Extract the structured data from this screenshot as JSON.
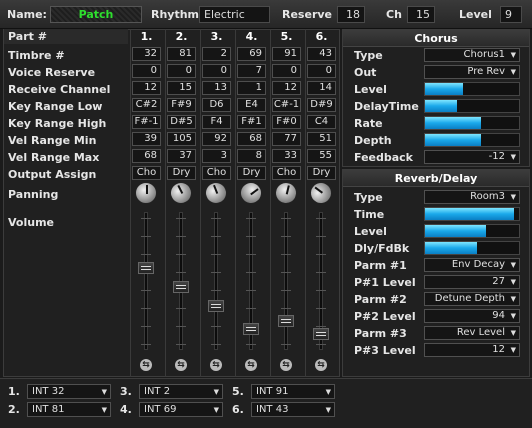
{
  "top": {
    "name_label": "Name:",
    "name_value": "Patch",
    "rhythm_label": "Rhythm",
    "rhythm_value": "Electric",
    "reserve_label": "Reserve",
    "reserve_value": "18",
    "ch_label": "Ch",
    "ch_value": "15",
    "level_label": "Level",
    "level_value": "9"
  },
  "parts": {
    "header_label": "Part #",
    "columns": [
      "1.",
      "2.",
      "3.",
      "4.",
      "5.",
      "6."
    ],
    "rows": [
      {
        "label": "Timbre #",
        "values": [
          "32",
          "81",
          "2",
          "69",
          "91",
          "43"
        ]
      },
      {
        "label": "Voice Reserve",
        "values": [
          "0",
          "0",
          "0",
          "7",
          "0",
          "0"
        ]
      },
      {
        "label": "Receive Channel",
        "values": [
          "12",
          "15",
          "13",
          "1",
          "12",
          "14"
        ]
      },
      {
        "label": "Key Range Low",
        "values": [
          "C#2",
          "F#9",
          "D6",
          "E4",
          "C#-1",
          "D#9"
        ]
      },
      {
        "label": "Key Range High",
        "values": [
          "F#-1",
          "D#5",
          "F4",
          "F#1",
          "F#0",
          "C4"
        ]
      },
      {
        "label": "Vel Range Min",
        "values": [
          "39",
          "105",
          "92",
          "68",
          "77",
          "51"
        ]
      },
      {
        "label": "Vel Range Max",
        "values": [
          "68",
          "37",
          "3",
          "8",
          "33",
          "55"
        ]
      },
      {
        "label": "Output Assign",
        "values": [
          "Cho",
          "Dry",
          "Cho",
          "Dry",
          "Cho",
          "Dry"
        ]
      }
    ],
    "panning_label": "Panning",
    "volume_label": "Volume",
    "panning": [
      0.5,
      0.4,
      0.42,
      0.7,
      0.55,
      0.3
    ],
    "volume": [
      0.6,
      0.45,
      0.3,
      0.12,
      0.18,
      0.08
    ]
  },
  "chorus": {
    "title": "Chorus",
    "params": [
      {
        "label": "Type",
        "kind": "select",
        "value": "Chorus1"
      },
      {
        "label": "Out",
        "kind": "select",
        "value": "Pre Rev"
      },
      {
        "label": "Level",
        "kind": "bar",
        "fraction": 0.4
      },
      {
        "label": "DelayTime",
        "kind": "bar",
        "fraction": 0.34
      },
      {
        "label": "Rate",
        "kind": "bar",
        "fraction": 0.6
      },
      {
        "label": "Depth",
        "kind": "bar",
        "fraction": 0.6
      },
      {
        "label": "Feedback",
        "kind": "select",
        "value": "-12"
      }
    ]
  },
  "reverb": {
    "title": "Reverb/Delay",
    "params": [
      {
        "label": "Type",
        "kind": "select",
        "value": "Room3"
      },
      {
        "label": "Time",
        "kind": "bar",
        "fraction": 0.95
      },
      {
        "label": "Level",
        "kind": "bar",
        "fraction": 0.65
      },
      {
        "label": "Dly/FdBk",
        "kind": "bar",
        "fraction": 0.55
      },
      {
        "label": "Parm #1",
        "kind": "select",
        "value": "Env Decay"
      },
      {
        "label": "P#1 Level",
        "kind": "select",
        "value": "27"
      },
      {
        "label": "Parm #2",
        "kind": "select",
        "value": "Detune Depth"
      },
      {
        "label": "P#2 Level",
        "kind": "select",
        "value": "94"
      },
      {
        "label": "Parm #3",
        "kind": "select",
        "value": "Rev Level"
      },
      {
        "label": "P#3 Level",
        "kind": "select",
        "value": "12"
      }
    ]
  },
  "bottom": {
    "slots": [
      {
        "label": "1.",
        "value": "INT 32"
      },
      {
        "label": "2.",
        "value": "INT 81"
      },
      {
        "label": "3.",
        "value": "INT 2"
      },
      {
        "label": "4.",
        "value": "INT 69"
      },
      {
        "label": "5.",
        "value": "INT 91"
      },
      {
        "label": "6.",
        "value": "INT 43"
      }
    ]
  }
}
